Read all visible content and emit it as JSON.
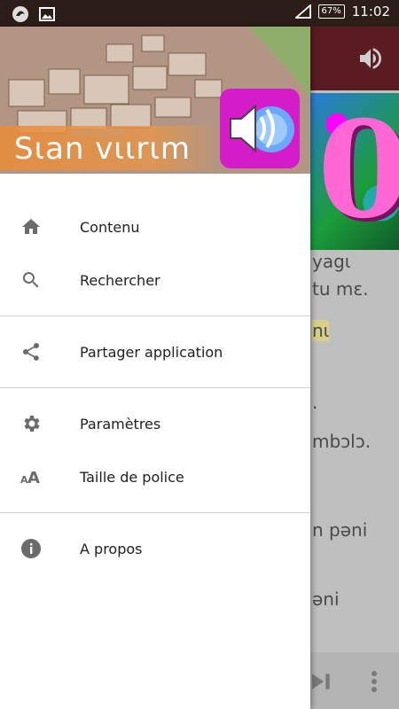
{
  "status_bar": {
    "battery": "67%",
    "time": "11:02"
  },
  "drawer": {
    "header_title": "Sɩan vɩɩrɩm",
    "groups": [
      [
        {
          "label": "Contenu",
          "icon": "home-icon"
        },
        {
          "label": "Rechercher",
          "icon": "search-icon"
        }
      ],
      [
        {
          "label": "Partager application",
          "icon": "share-icon"
        }
      ],
      [
        {
          "label": "Paramètres",
          "icon": "gear-icon"
        },
        {
          "label": "Taille de police",
          "icon": "font-size-icon"
        }
      ],
      [
        {
          "label": "A propos",
          "icon": "info-icon"
        }
      ]
    ]
  },
  "background_text": {
    "line1": "yagɩ",
    "line2": "tu mɛ.",
    "line3": "nɩ",
    "line4": ".",
    "line5": "mbɔlɔ.",
    "line6": "n pəni",
    "line7": "əni"
  },
  "colors": {
    "status_bar": "#2d1d19",
    "toolbar": "#5b1b22",
    "icon_gray": "#6b6b6b",
    "header_banner": "#e88c3c"
  }
}
